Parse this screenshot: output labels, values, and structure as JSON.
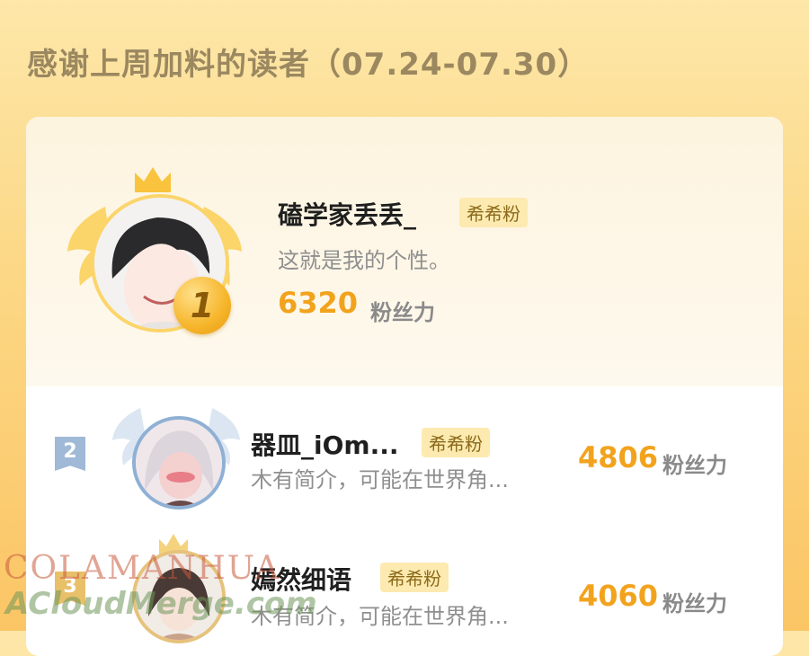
{
  "header": {
    "title": "感谢上周加料的读者（07.24-07.30）"
  },
  "top_reader": {
    "rank": "1",
    "name": "磕学家丢丢_",
    "badge": "希希粉",
    "bio": "这就是我的个性。",
    "score": "6320",
    "score_unit": "粉丝力",
    "avatar_icon": "avatar-icon",
    "crown_icon": "crown-icon"
  },
  "readers": [
    {
      "rank": "2",
      "name": "器皿_iOm...",
      "badge": "希希粉",
      "bio": "木有简介，可能在世界角...",
      "score": "4806",
      "score_unit": "粉丝力"
    },
    {
      "rank": "3",
      "name": "嫣然细语",
      "badge": "希希粉",
      "bio": "木有简介，可能在世界角...",
      "score": "4060",
      "score_unit": "粉丝力"
    }
  ],
  "watermark": {
    "line1": "COLAMANHUA",
    "line2": "ACloudMerge.com"
  },
  "colors": {
    "accent": "#f2a31d",
    "background": "#fcd784",
    "badge_bg": "#fdeab0",
    "rank2": "#9fb9d6"
  }
}
